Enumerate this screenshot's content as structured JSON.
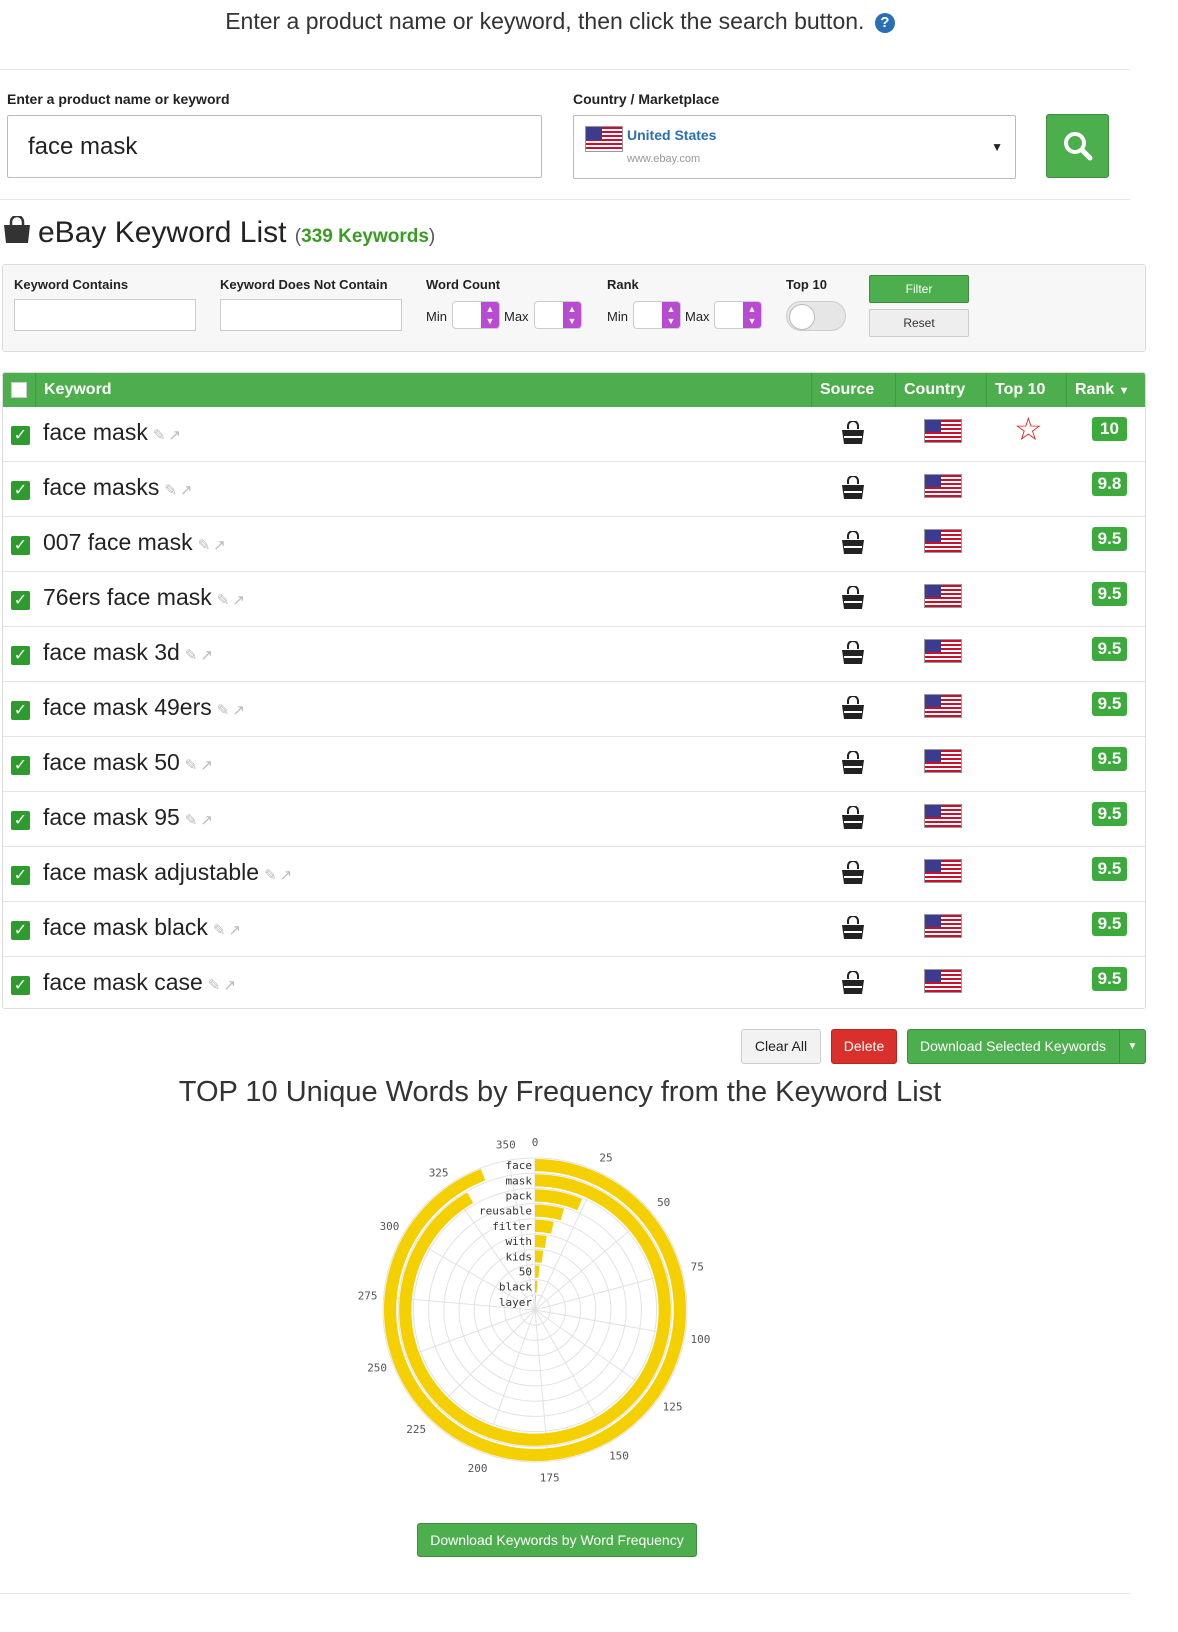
{
  "header": {
    "instruction": "Enter a product name or keyword, then click the search button.",
    "help_icon": "?"
  },
  "search": {
    "keyword_label": "Enter a product name or keyword",
    "keyword_value": "face mask",
    "country_label": "Country / Marketplace",
    "country_name": "United States",
    "country_url": "www.ebay.com"
  },
  "list": {
    "title": "eBay Keyword List",
    "count_open": "(",
    "count_text": "339 Keywords",
    "count_close": ")"
  },
  "filters": {
    "contains_label": "Keyword Contains",
    "not_contains_label": "Keyword Does Not Contain",
    "word_count_label": "Word Count",
    "rank_label": "Rank",
    "top10_label": "Top 10",
    "min_label": "Min",
    "max_label": "Max",
    "filter_button": "Filter",
    "reset_button": "Reset"
  },
  "table": {
    "columns": [
      "Keyword",
      "Source",
      "Country",
      "Top 10",
      "Rank"
    ],
    "rows": [
      {
        "keyword": "face mask",
        "top10": true,
        "rank": "10"
      },
      {
        "keyword": "face masks",
        "top10": false,
        "rank": "9.8"
      },
      {
        "keyword": "007 face mask",
        "top10": false,
        "rank": "9.5"
      },
      {
        "keyword": "76ers face mask",
        "top10": false,
        "rank": "9.5"
      },
      {
        "keyword": "face mask 3d",
        "top10": false,
        "rank": "9.5"
      },
      {
        "keyword": "face mask 49ers",
        "top10": false,
        "rank": "9.5"
      },
      {
        "keyword": "face mask 50",
        "top10": false,
        "rank": "9.5"
      },
      {
        "keyword": "face mask 95",
        "top10": false,
        "rank": "9.5"
      },
      {
        "keyword": "face mask adjustable",
        "top10": false,
        "rank": "9.5"
      },
      {
        "keyword": "face mask black",
        "top10": false,
        "rank": "9.5"
      },
      {
        "keyword": "face mask case",
        "top10": false,
        "rank": "9.5"
      }
    ]
  },
  "actions": {
    "clear_all": "Clear All",
    "delete": "Delete",
    "download_selected": "Download Selected Keywords"
  },
  "frequency": {
    "title": "TOP 10 Unique Words by Frequency from the Keyword List",
    "download_button": "Download Keywords by Word Frequency"
  },
  "chart_data": {
    "type": "bar",
    "orientation": "radial",
    "categories": [
      "face",
      "mask",
      "pack",
      "reusable",
      "filter",
      "with",
      "kids",
      "50",
      "black",
      "layer"
    ],
    "values": [
      339,
      330,
      23,
      16,
      12,
      9,
      8,
      6,
      5,
      4
    ],
    "axis_ticks": [
      0,
      25,
      50,
      75,
      100,
      125,
      150,
      175,
      200,
      225,
      250,
      275,
      300,
      325,
      350
    ],
    "ylim": [
      0,
      360
    ],
    "bar_color": "#f5d000",
    "grid": true
  }
}
